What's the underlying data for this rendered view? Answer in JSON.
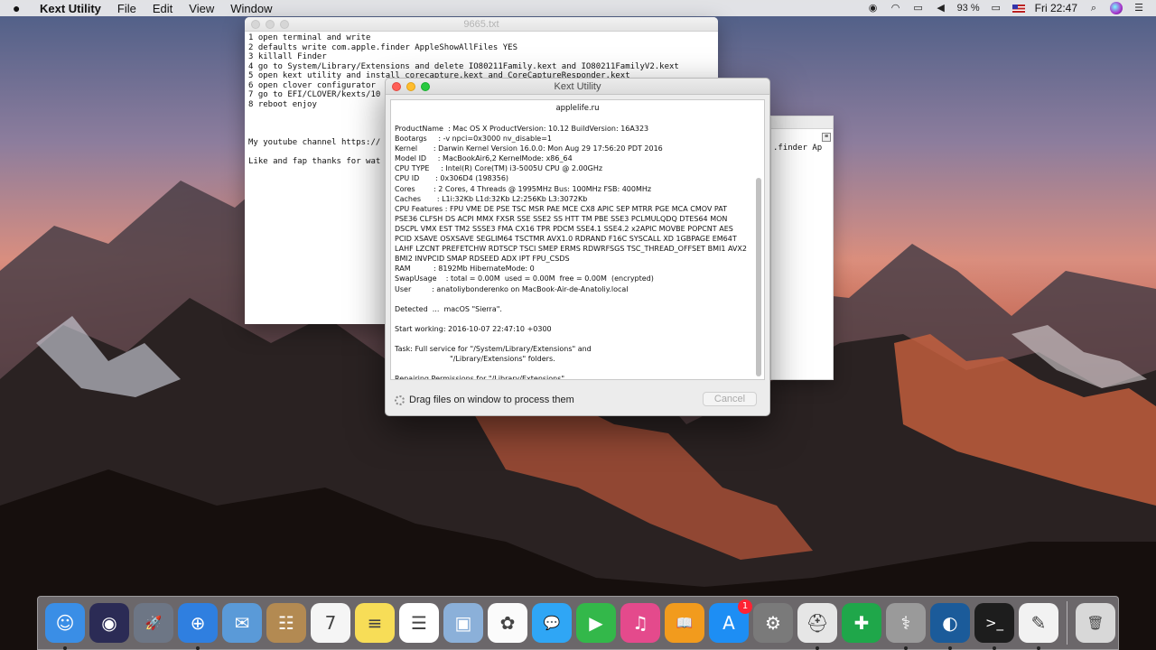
{
  "menubar": {
    "app_name": "Kext Utility",
    "menus": [
      "File",
      "Edit",
      "View",
      "Window"
    ],
    "battery": "93 %",
    "clock": "Fri 22:47"
  },
  "textedit": {
    "title": "9665.txt",
    "lines": [
      "1 open terminal and write",
      "2 defaults write com.apple.finder AppleShowAllFiles YES",
      "3 killall Finder",
      "4 go to System/Library/Extensions and delete IO80211Family.kext and IO80211FamilyV2.kext",
      "5 open kext utility and install corecapture.kext and CoreCaptureResponder.kext",
      "6 open clover configurator",
      "7 go to EFI/CLOVER/kexts/10",
      "8 reboot enjoy",
      "",
      "",
      "",
      "My youtube channel https://",
      "",
      "Like and fap thanks for wat"
    ]
  },
  "second_window": {
    "snippet": ".finder Ap"
  },
  "kext_window": {
    "title": "Kext Utility",
    "header": "applelife.ru",
    "log_lines": [
      "ProductName  : Mac OS X ProductVersion: 10.12 BuildVersion: 16A323",
      "Bootargs     : -v npci=0x3000 nv_disable=1",
      "Kernel       : Darwin Kernel Version 16.0.0: Mon Aug 29 17:56:20 PDT 2016",
      "Model ID     : MacBookAir6,2 KernelMode: x86_64",
      "CPU TYPE     : Intel(R) Core(TM) i3-5005U CPU @ 2.00GHz",
      "CPU ID       : 0x306D4 (198356)",
      "Cores        : 2 Cores, 4 Threads @ 1995MHz Bus: 100MHz FSB: 400MHz",
      "Caches       : L1i:32Kb L1d:32Kb L2:256Kb L3:3072Kb",
      "CPU Features : FPU VME DE PSE TSC MSR PAE MCE CX8 APIC SEP MTRR PGE MCA CMOV PAT",
      "PSE36 CLFSH DS ACPI MMX FXSR SSE SSE2 SS HTT TM PBE SSE3 PCLMULQDQ DTES64 MON",
      "DSCPL VMX EST TM2 SSSE3 FMA CX16 TPR PDCM SSE4.1 SSE4.2 x2APIC MOVBE POPCNT AES",
      "PCID XSAVE OSXSAVE SEGLIM64 TSCTMR AVX1.0 RDRAND F16C SYSCALL XD 1GBPAGE EM64T",
      "LAHF LZCNT PREFETCHW RDTSCP TSCI SMEP ERMS RDWRFSGS TSC_THREAD_OFFSET BMI1 AVX2",
      "BMI2 INVPCID SMAP RDSEED ADX IPT FPU_CSDS",
      "RAM          : 8192Mb HibernateMode: 0",
      "SwapUsage    : total = 0.00M  used = 0.00M  free = 0.00M  (encrypted)",
      "User         : anatoliybonderenko on MacBook-Air-de-Anatoliy.local",
      "",
      "Detected  ...  macOS \"Sierra\".",
      "",
      "Start working: 2016-10-07 22:47:10 +0300",
      "",
      "Task: Full service for \"/System/Library/Extensions\" and",
      "                        \"/Library/Extensions\" folders.",
      "",
      "Repairing Permissions for \"/Library/Extensions\" ..."
    ],
    "status_text": "Drag files on window to process them",
    "cancel_label": "Cancel"
  },
  "dock": {
    "items": [
      {
        "name": "finder-icon",
        "glyph": "☺",
        "color": "#3a8ee6",
        "running": true
      },
      {
        "name": "siri-icon",
        "glyph": "◉",
        "color": "#2b2b55",
        "running": false
      },
      {
        "name": "launchpad-icon",
        "glyph": "🚀",
        "color": "#6d7685",
        "running": false
      },
      {
        "name": "safari-icon",
        "glyph": "⊕",
        "color": "#2f7fe0",
        "running": true
      },
      {
        "name": "mail-icon",
        "glyph": "✉",
        "color": "#5a9ad8",
        "running": false
      },
      {
        "name": "contacts-icon",
        "glyph": "☷",
        "color": "#b38a52",
        "running": false
      },
      {
        "name": "calendar-icon",
        "glyph": "7",
        "color": "#f5f5f5",
        "running": false
      },
      {
        "name": "notes-icon",
        "glyph": "≡",
        "color": "#f7dd57",
        "running": false
      },
      {
        "name": "reminders-icon",
        "glyph": "☰",
        "color": "#ffffff",
        "running": false
      },
      {
        "name": "preview-icon",
        "glyph": "▣",
        "color": "#8bb0d9",
        "running": false
      },
      {
        "name": "photos-icon",
        "glyph": "✿",
        "color": "#fbfbfb",
        "running": false
      },
      {
        "name": "messages-icon",
        "glyph": "💬",
        "color": "#2fa6f5",
        "running": false
      },
      {
        "name": "facetime-icon",
        "glyph": "▶",
        "color": "#33b84a",
        "running": false
      },
      {
        "name": "itunes-icon",
        "glyph": "♫",
        "color": "#e44a8c",
        "running": false
      },
      {
        "name": "ibooks-icon",
        "glyph": "📖",
        "color": "#f29b1d",
        "running": false
      },
      {
        "name": "app-store-icon",
        "glyph": "A",
        "color": "#1d8ef4",
        "running": false,
        "badge": "1"
      },
      {
        "name": "system-preferences-icon",
        "glyph": "⚙",
        "color": "#7a7a7a",
        "running": false
      },
      {
        "name": "kext-utility-icon",
        "glyph": "⛑",
        "color": "#e6e6e6",
        "running": true
      },
      {
        "name": "vibrant-icon",
        "glyph": "✚",
        "color": "#1fa74a",
        "running": false
      },
      {
        "name": "disk-utility-icon",
        "glyph": "⚕",
        "color": "#9a9a9a",
        "running": true
      },
      {
        "name": "quicktime-icon",
        "glyph": "◐",
        "color": "#1b5b9a",
        "running": true
      },
      {
        "name": "terminal-icon",
        "glyph": ">_",
        "color": "#1d1d1d",
        "running": true
      },
      {
        "name": "textedit-icon",
        "glyph": "✎",
        "color": "#f2f2f2",
        "running": true
      },
      {
        "name": "trash-icon",
        "glyph": "🗑",
        "color": "#d8d8d8",
        "running": false
      }
    ]
  }
}
